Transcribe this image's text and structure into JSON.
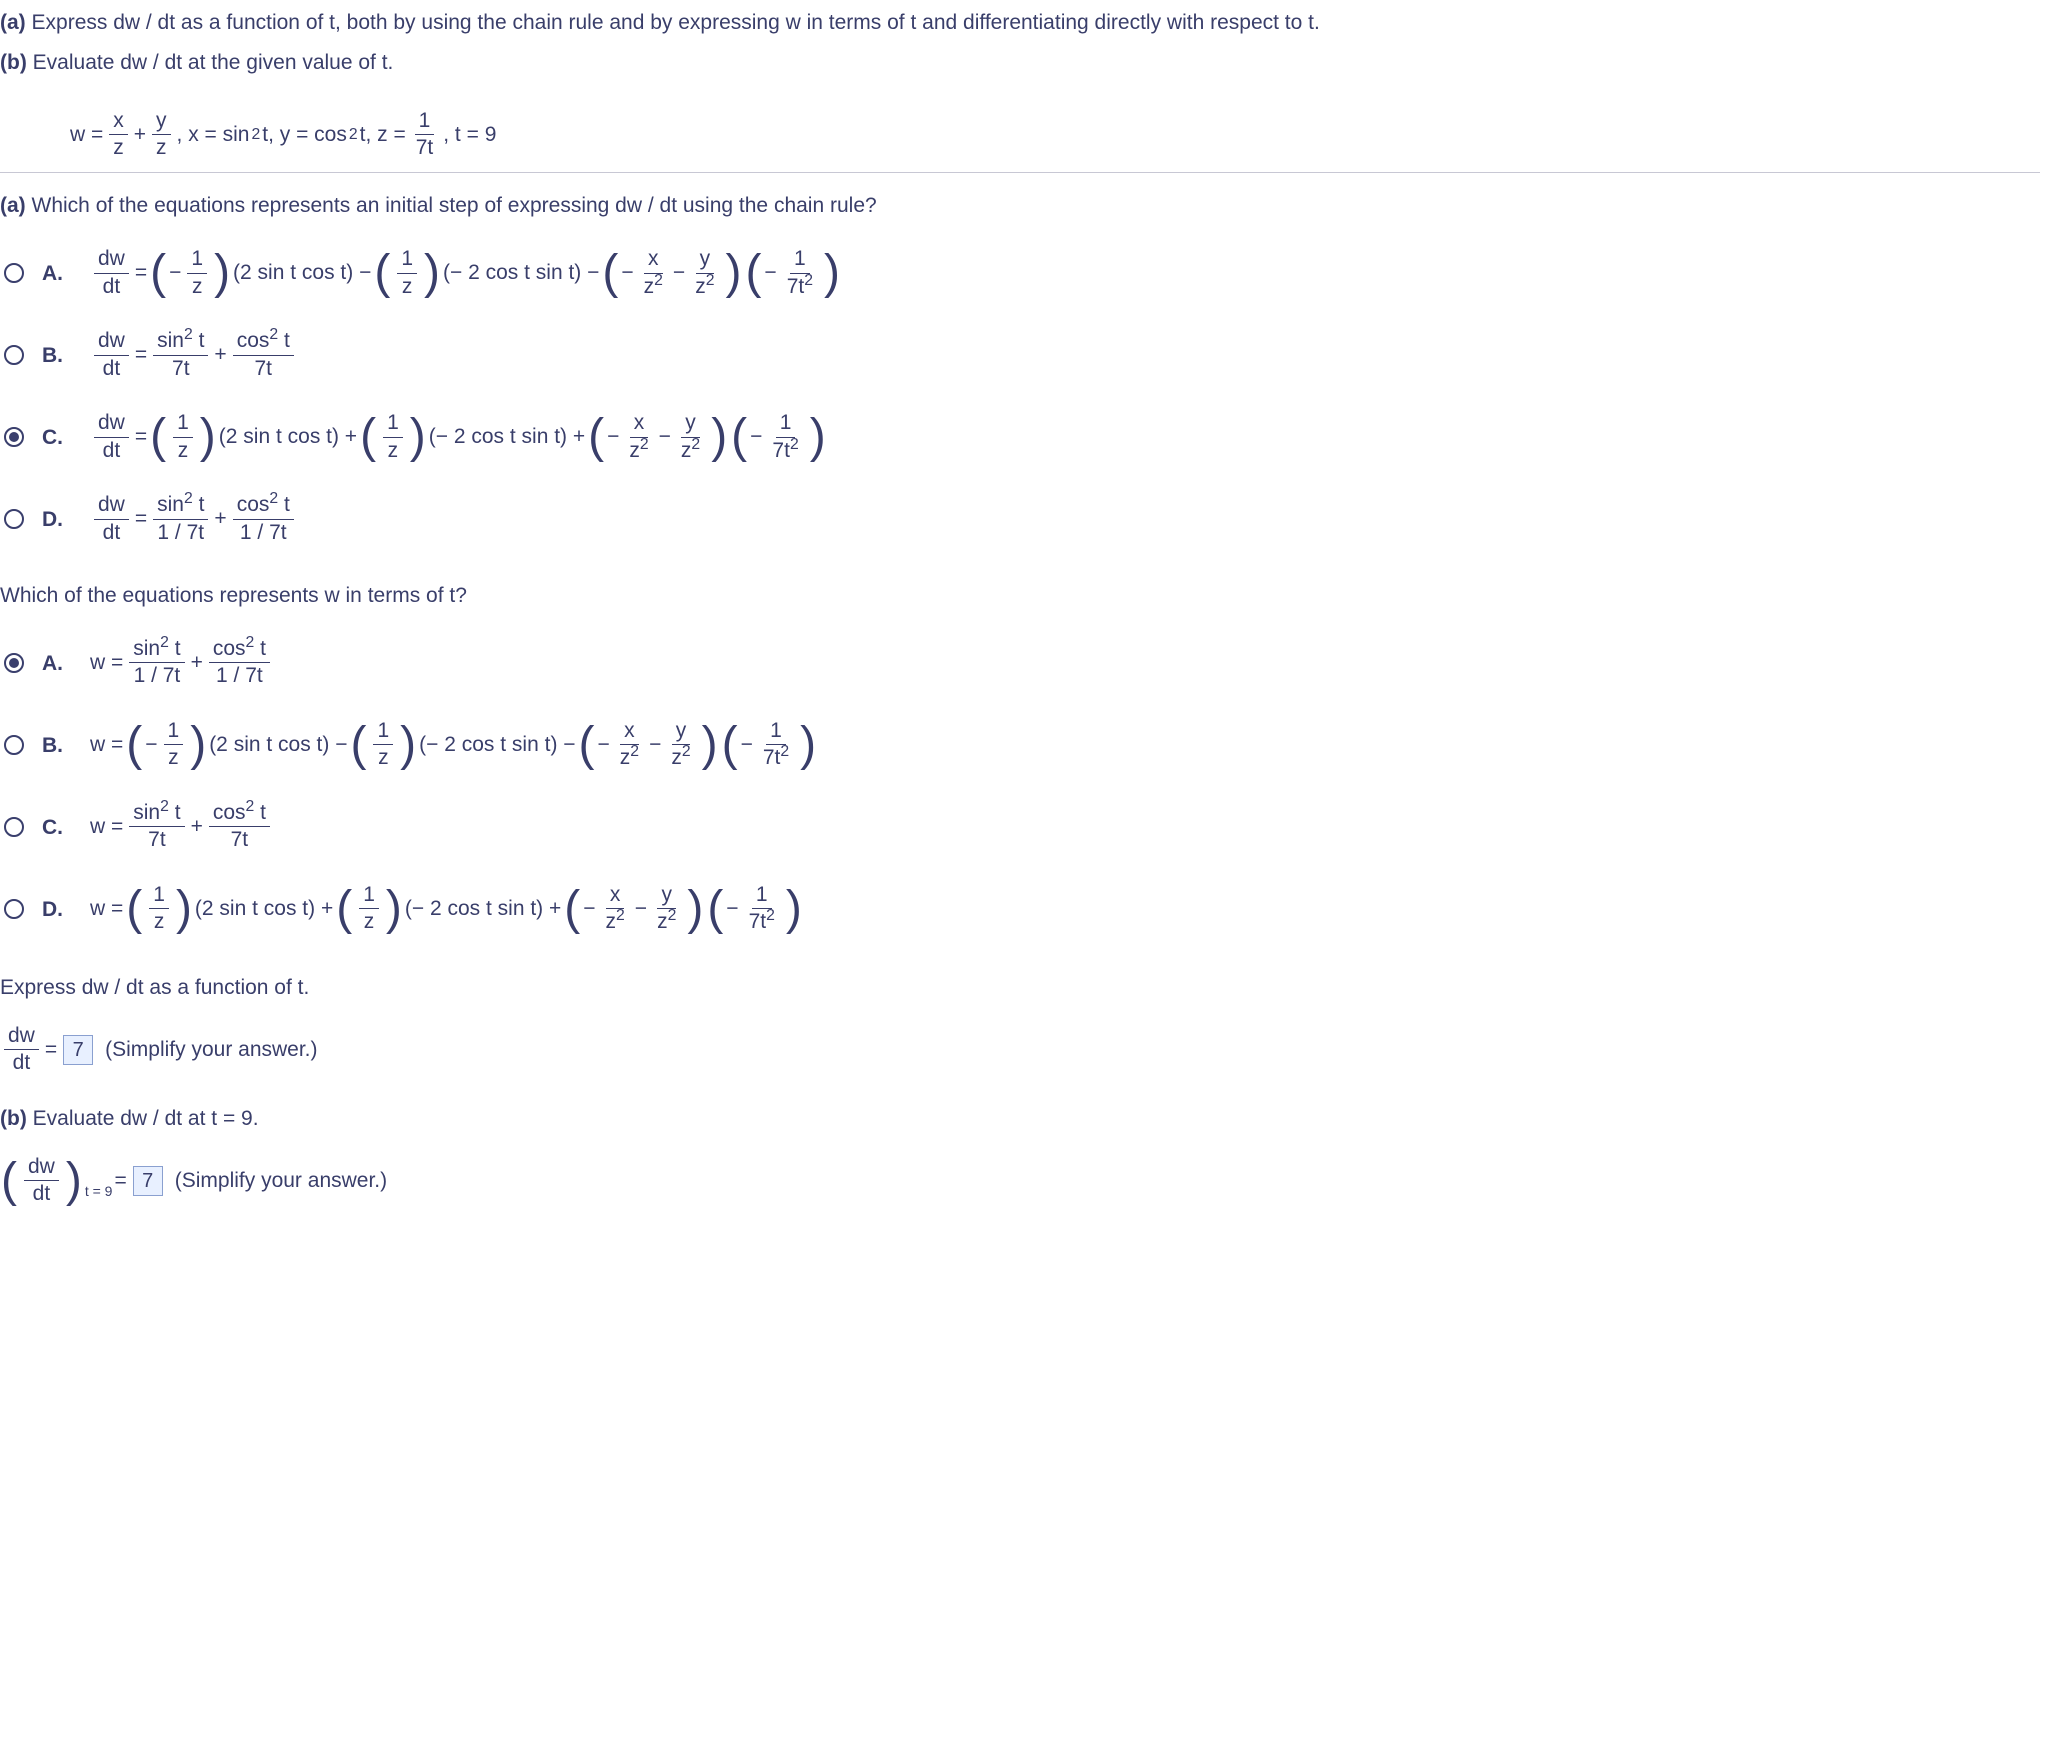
{
  "partA": {
    "label": "(a)",
    "text": "Express dw / dt as a function of t, both by using the chain rule and by expressing w in terms of t and differentiating directly with respect to t."
  },
  "partB": {
    "label": "(b)",
    "text": "Evaluate dw / dt at the given value of t."
  },
  "given": {
    "w_eq": "w = ",
    "x_eq": ", x = sin",
    "x_exp": "2",
    "x_t": " t, y = cos",
    "y_exp": "2",
    "y_t": " t, z = ",
    "z_num": "1",
    "z_den": "7t",
    "t_eq": ", t = 9",
    "wx_num": "x",
    "wx_den": "z",
    "wy_num": "y",
    "wy_den": "z",
    "plus": " + "
  },
  "q1": {
    "label": "(a)",
    "text": "Which of the equations represents an initial step of expressing dw / dt using the chain rule?",
    "selected": "C",
    "options": {
      "A": {
        "lhs_num": "dw",
        "lhs_den": "dt",
        "eq": " = ",
        "p1_n": "1",
        "p1_d": "z",
        "p1_sign": "− ",
        "p1_trig": "(2 sin t cos t) −",
        "p2_n": "1",
        "p2_d": "z",
        "p2_trig": "(− 2 cos t sin t) −",
        "p3a_n": "x",
        "p3a_d": "z",
        "p3a_exp": "2",
        "p3b_n": "y",
        "p3b_d": "z",
        "p3b_exp": "2",
        "p3_sign": "− ",
        "p3_mid": " − ",
        "p4_n": "1",
        "p4_d": "7t",
        "p4_exp": "2",
        "p4_sign": "− "
      },
      "B": {
        "lhs_num": "dw",
        "lhs_den": "dt",
        "eq": " = ",
        "t1_num": "sin",
        "t1_exp": "2",
        "t1_t": " t",
        "t1_den": "7t",
        "plus": " + ",
        "t2_num": "cos",
        "t2_exp": "2",
        "t2_t": " t",
        "t2_den": "7t"
      },
      "C": {
        "lhs_num": "dw",
        "lhs_den": "dt",
        "eq": " = ",
        "p1_n": "1",
        "p1_d": "z",
        "p1_trig": "(2 sin t cos t) +",
        "p2_n": "1",
        "p2_d": "z",
        "p2_trig": "(− 2 cos t sin t) +",
        "p3a_n": "x",
        "p3a_d": "z",
        "p3a_exp": "2",
        "p3b_n": "y",
        "p3b_d": "z",
        "p3b_exp": "2",
        "p3_sign": "− ",
        "p3_mid": " − ",
        "p4_n": "1",
        "p4_d": "7t",
        "p4_exp": "2",
        "p4_sign": "− "
      },
      "D": {
        "lhs_num": "dw",
        "lhs_den": "dt",
        "eq": " = ",
        "t1_num": "sin",
        "t1_exp": "2",
        "t1_t": " t",
        "t1_den": "1 / 7t",
        "plus": " + ",
        "t2_num": "cos",
        "t2_exp": "2",
        "t2_t": " t",
        "t2_den": "1 / 7t"
      }
    }
  },
  "q2": {
    "text": "Which of the equations represents w in terms of t?",
    "selected": "A",
    "options": {
      "A": {
        "lhs": "w = ",
        "t1_num": "sin",
        "t1_exp": "2",
        "t1_t": " t",
        "t1_den": "1 / 7t",
        "plus": " + ",
        "t2_num": "cos",
        "t2_exp": "2",
        "t2_t": " t",
        "t2_den": "1 / 7t"
      },
      "B": {
        "lhs": "w = ",
        "p1_n": "1",
        "p1_d": "z",
        "p1_sign": "− ",
        "p1_trig": "(2 sin t cos t) −",
        "p2_n": "1",
        "p2_d": "z",
        "p2_trig": "(− 2 cos t sin t) −",
        "p3a_n": "x",
        "p3a_d": "z",
        "p3a_exp": "2",
        "p3b_n": "y",
        "p3b_d": "z",
        "p3b_exp": "2",
        "p3_sign": "− ",
        "p3_mid": " − ",
        "p4_n": "1",
        "p4_d": "7t",
        "p4_exp": "2",
        "p4_sign": "− "
      },
      "C": {
        "lhs": "w = ",
        "t1_num": "sin",
        "t1_exp": "2",
        "t1_t": " t",
        "t1_den": "7t",
        "plus": " + ",
        "t2_num": "cos",
        "t2_exp": "2",
        "t2_t": " t",
        "t2_den": "7t"
      },
      "D": {
        "lhs": "w = ",
        "p1_n": "1",
        "p1_d": "z",
        "p1_trig": "(2 sin t cos t) +",
        "p2_n": "1",
        "p2_d": "z",
        "p2_trig": "(− 2 cos t sin t) +",
        "p3a_n": "x",
        "p3a_d": "z",
        "p3a_exp": "2",
        "p3b_n": "y",
        "p3b_d": "z",
        "p3b_exp": "2",
        "p3_sign": "− ",
        "p3_mid": " − ",
        "p4_n": "1",
        "p4_d": "7t",
        "p4_exp": "2",
        "p4_sign": "− "
      }
    }
  },
  "express": {
    "text": "Express dw / dt as a function of t.",
    "lhs_num": "dw",
    "lhs_den": "dt",
    "eq": " = ",
    "value": "7",
    "hint": "(Simplify your answer.)"
  },
  "partBq": {
    "label": "(b)",
    "text": "Evaluate dw / dt at t = 9.",
    "lhs_num": "dw",
    "lhs_den": "dt",
    "sub": "t = 9",
    "eq": " = ",
    "value": "7",
    "hint": "(Simplify your answer.)"
  }
}
